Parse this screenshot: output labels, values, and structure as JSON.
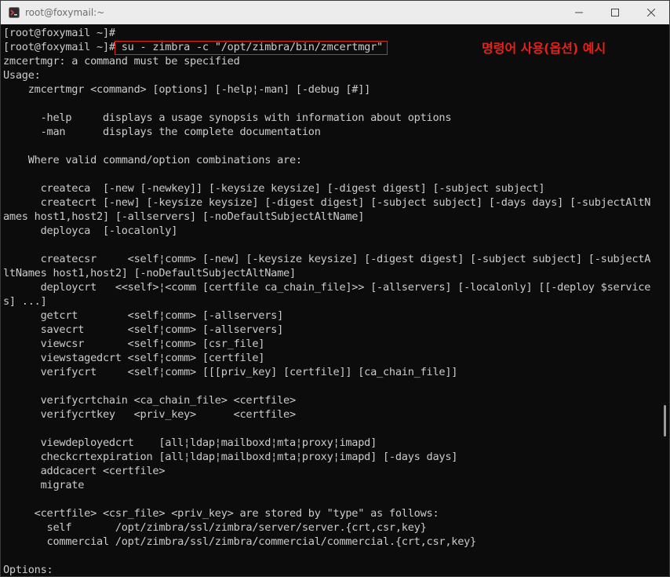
{
  "window": {
    "title": "root@foxymail:~",
    "controls": [
      "minimize",
      "maximize",
      "close"
    ]
  },
  "annotation": {
    "text": "명령어 사용(옵션) 예시",
    "color": "#e8201a"
  },
  "terminal": {
    "lines": [
      "[root@foxymail ~]#",
      "[root@foxymail ~]# su - zimbra -c \"/opt/zimbra/bin/zmcertmgr\"",
      "zmcertmgr: a command must be specified",
      "Usage:",
      "    zmcertmgr <command> [options] [-help¦-man] [-debug [#]]",
      "",
      "      -help     displays a usage synopsis with information about options",
      "      -man      displays the complete documentation",
      "",
      "    Where valid command/option combinations are:",
      "",
      "      createca  [-new [-newkey]] [-keysize keysize] [-digest digest] [-subject subject]",
      "      createcrt [-new] [-keysize keysize] [-digest digest] [-subject subject] [-days days] [-subjectAltN",
      "ames host1,host2] [-allservers] [-noDefaultSubjectAltName]",
      "      deployca  [-localonly]",
      "",
      "      createcsr     <self¦comm> [-new] [-keysize keysize] [-digest digest] [-subject subject] [-subjectA",
      "ltNames host1,host2] [-noDefaultSubjectAltName]",
      "      deploycrt   <<self>¦<comm [certfile ca_chain_file]>> [-allservers] [-localonly] [[-deploy $service",
      "s] ...]",
      "      getcrt        <self¦comm> [-allservers]",
      "      savecrt       <self¦comm> [-allservers]",
      "      viewcsr       <self¦comm> [csr_file]",
      "      viewstagedcrt <self¦comm> [certfile]",
      "      verifycrt     <self¦comm> [[[priv_key] [certfile]] [ca_chain_file]]",
      "",
      "      verifycrtchain <ca_chain_file> <certfile>",
      "      verifycrtkey   <priv_key>      <certfile>",
      "",
      "      viewdeployedcrt    [all¦ldap¦mailboxd¦mta¦proxy¦imapd]",
      "      checkcrtexpiration [all¦ldap¦mailboxd¦mta¦proxy¦imapd] [-days days]",
      "      addcacert <certfile>",
      "      migrate",
      "",
      "     <certfile> <csr_file> <priv_key> are stored by \"type\" as follows:",
      "       self       /opt/zimbra/ssl/zimbra/server/server.{crt,csr,key}",
      "       commercial /opt/zimbra/ssl/zimbra/commercial/commercial.{crt,csr,key}",
      "",
      "Options:"
    ]
  }
}
